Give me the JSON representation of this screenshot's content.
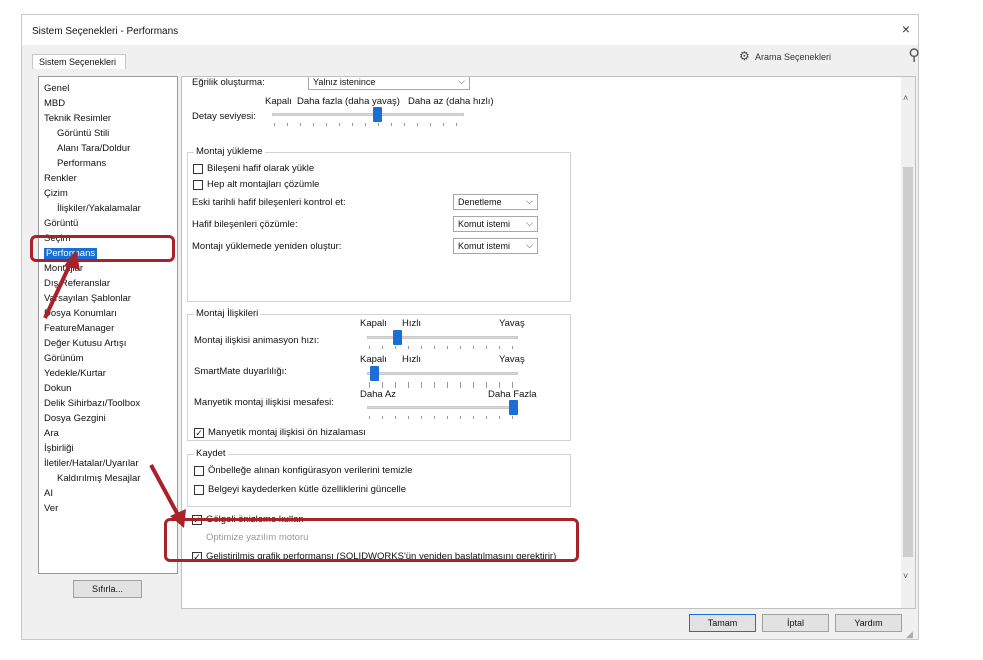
{
  "window": {
    "title": "Sistem Seçenekleri - Performans",
    "close": "×"
  },
  "tab": {
    "label": "Sistem Seçenekleri"
  },
  "search": {
    "placeholder": "Arama Seçenekleri"
  },
  "tree": {
    "items": [
      "Genel",
      "MBD",
      "Teknik Resimler",
      "Görüntü Stili",
      "Alanı Tara/Doldur",
      "Performans",
      "Renkler",
      "Çizim",
      "İlişkiler/Yakalamalar",
      "Görüntü",
      "Seçim",
      "Performans",
      "Montajlar",
      "Dış Referanslar",
      "Varsayılan Şablonlar",
      "Dosya Konumları",
      "FeatureManager",
      "Değer Kutusu Artışı",
      "Görünüm",
      "Yedekle/Kurtar",
      "Dokun",
      "Delik Sihirbazı/Toolbox",
      "Dosya Gezgini",
      "Ara",
      "İşbirliği",
      "İletiler/Hatalar/Uyarılar",
      "Kaldırılmış Mesajlar",
      "AI",
      "Ver"
    ],
    "selected": "Performans"
  },
  "reset_label": "Sıfırla...",
  "curvature": {
    "label": "Eğrilik oluşturma:",
    "value": "Yalnız istenince"
  },
  "detail": {
    "label": "Detay seviyesi:",
    "left": "Kapalı",
    "mid": "Daha fazla (daha yavaş)",
    "right": "Daha az (daha hızlı)",
    "level": 0.55
  },
  "assembly_load": {
    "title": "Montaj yükleme",
    "lightweight": "Bileşeni hafif olarak yükle",
    "resolve_all": "Hep alt montajları çözümle",
    "check_old": {
      "label": "Eski tarihli hafif bileşenleri kontrol et:",
      "value": "Denetleme"
    },
    "resolve_light": {
      "label": "Hafif bileşenleri çözümle:",
      "value": "Komut istemi"
    },
    "rebuild": {
      "label": "Montajı yüklemede yeniden oluştur:",
      "value": "Komut istemi"
    }
  },
  "mates": {
    "title": "Montaj İlişkileri",
    "anim": {
      "label": "Montaj ilişkisi animasyon hızı:",
      "left": "Kapalı",
      "mid": "Hızlı",
      "right": "Yavaş",
      "level": 0.18
    },
    "smartmate": {
      "label": "SmartMate duyarlılığı:",
      "left": "Kapalı",
      "mid": "Hızlı",
      "right": "Yavaş",
      "level": 0.02
    },
    "magnetic": {
      "label": "Manyetik montaj ilişkisi mesafesi:",
      "left": "Daha Az",
      "right": "Daha Fazla",
      "level": 1.0
    },
    "prealign": "Manyetik montaj ilişkisi ön hizalaması"
  },
  "save": {
    "title": "Kaydet",
    "purge": "Önbelleğe alınan konfigürasyon verilerini temizle",
    "mass": "Belgeyi kaydederken kütle özelliklerini güncelle"
  },
  "shaded_preview": "Gölgeli önizleme kullan",
  "hidden_option": "Optimize yazılım motoru",
  "enhanced_graphics": "Geliştirilmiş grafik performansı (SOLIDWORKS'ün yeniden başlatılmasını gerektirir)",
  "buttons": {
    "ok": "Tamam",
    "cancel": "İptal",
    "help": "Yardım"
  },
  "colors": {
    "accent": "#1a6fd6",
    "highlight": "#a8222b"
  }
}
